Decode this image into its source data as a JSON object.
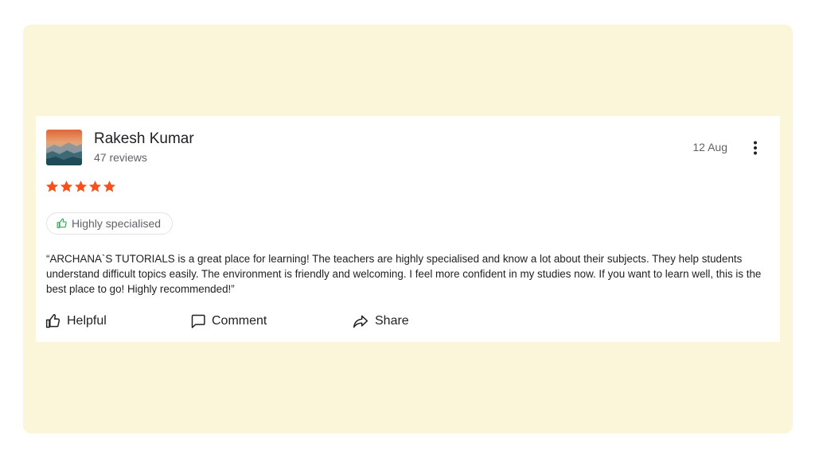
{
  "review": {
    "reviewer_name": "Rakesh Kumar",
    "review_count": "47 reviews",
    "date": "12 Aug",
    "rating": 5,
    "star_color": "#f4511e",
    "tag": {
      "label": "Highly specialised",
      "icon": "thumbs-up-icon",
      "icon_color": "#34a853"
    },
    "text": "“ARCHANA`S TUTORIALS is a great place for learning! The teachers are highly specialised and know a lot about their subjects. They help students understand difficult topics easily. The environment is friendly and welcoming. I feel more confident in my studies now. If you want to learn well, this is the best place to go! Highly recommended!”"
  },
  "actions": {
    "helpful": {
      "label": "Helpful",
      "icon": "thumbs-up-icon"
    },
    "comment": {
      "label": "Comment",
      "icon": "comment-icon"
    },
    "share": {
      "label": "Share",
      "icon": "share-icon"
    }
  },
  "menu": {
    "icon": "more-vertical-icon"
  },
  "colors": {
    "background_panel": "#fbf5d9",
    "card": "#ffffff",
    "text_primary": "#202124",
    "text_secondary": "#5f6368"
  }
}
